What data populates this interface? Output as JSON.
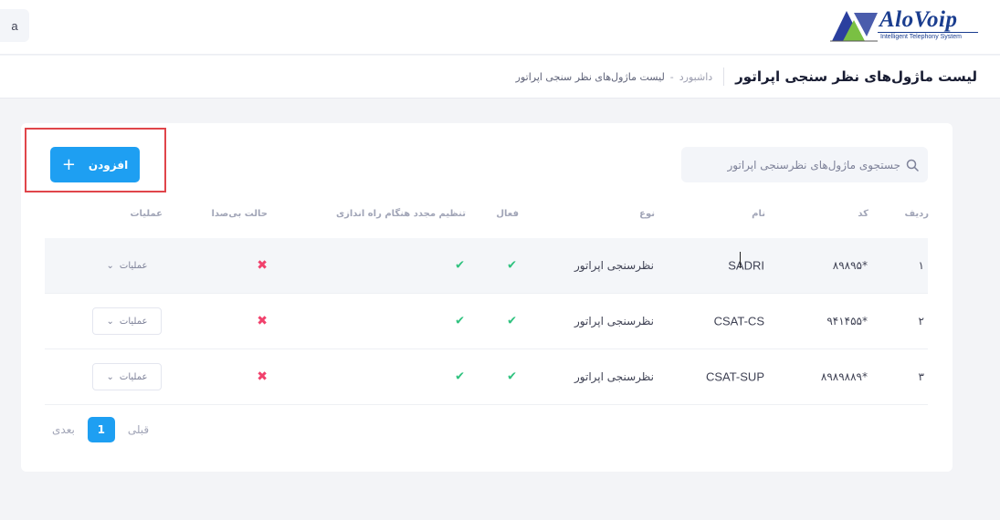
{
  "header": {
    "user_initial": "a",
    "logo_name": "AloVoip",
    "logo_tagline": "Intelligent Telephony System"
  },
  "subheader": {
    "title": "لیست ماژول‌های نظر سنجی اپراتور",
    "breadcrumb": {
      "home": "داشبورد",
      "separator": "-",
      "current": "لیست ماژول‌های نظر سنجی اپراتور"
    }
  },
  "toolbar": {
    "search_placeholder": "جستجوی ماژول‌های نظرسنجی اپراتور",
    "add_label": "افزودن"
  },
  "table": {
    "columns": {
      "row": "ردیف",
      "code": "کد",
      "name": "نام",
      "type": "نوع",
      "active": "فعال",
      "reset_on_start": "تنظیم مجدد هنگام راه اندازی",
      "mute": "حالت بی‌صدا",
      "actions": "عملیات"
    },
    "rows": [
      {
        "index": "۱",
        "code": "*۸۹۸۹۵",
        "name": "SADRI",
        "type": "نظرسنجی اپراتور",
        "active": true,
        "reset_on_start": true,
        "mute": false,
        "actions_label": "عملیات"
      },
      {
        "index": "۲",
        "code": "*۹۴۱۴۵۵",
        "name": "CSAT-CS",
        "type": "نظرسنجی اپراتور",
        "active": true,
        "reset_on_start": true,
        "mute": false,
        "actions_label": "عملیات"
      },
      {
        "index": "۳",
        "code": "*۸۹۸۹۸۸۹",
        "name": "CSAT-SUP",
        "type": "نظرسنجی اپراتور",
        "active": true,
        "reset_on_start": true,
        "mute": false,
        "actions_label": "عملیات"
      }
    ],
    "icons": {
      "yes": "check-icon",
      "no": "cross-icon"
    }
  },
  "pagination": {
    "next_label": "بعدی",
    "current_page": "1",
    "prev_label": "قبلی"
  },
  "colors": {
    "primary": "#1e9ff2",
    "success": "#2ec27e",
    "danger": "#f1416c",
    "highlight_border": "#e0454a"
  }
}
